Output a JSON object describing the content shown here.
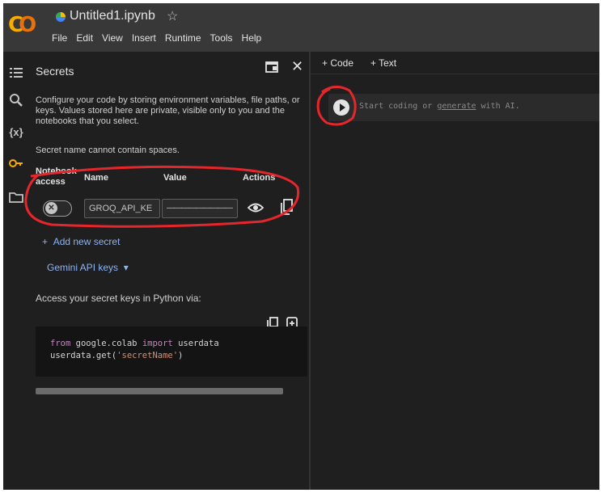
{
  "app": {
    "logo": "CO",
    "notebook_title": "Untitled1.ipynb"
  },
  "menu": [
    "File",
    "Edit",
    "View",
    "Insert",
    "Runtime",
    "Tools",
    "Help"
  ],
  "rail": [
    "toc-icon",
    "search-icon",
    "variables-icon",
    "key-icon",
    "folder-icon"
  ],
  "rail_variables_label": "{x}",
  "secrets": {
    "title": "Secrets",
    "description": "Configure your code by storing environment variables, file paths, or keys. Values stored here are private, visible only to you and the notebooks that you select.",
    "warning": "Secret name cannot contain spaces.",
    "columns": {
      "access": "Notebook access",
      "name": "Name",
      "value": "Value",
      "actions": "Actions"
    },
    "row": {
      "name": "GROQ_API_KE",
      "value": "—————————",
      "access_enabled": false
    },
    "add_secret": "Add new secret",
    "gemini_keys": "Gemini API keys",
    "access_text": "Access your secret keys in Python via:",
    "code_line1_kw1": "from",
    "code_line1_mod": " google.colab ",
    "code_line1_kw2": "import",
    "code_line1_name": " userdata",
    "code_line2_a": "userdata.get(",
    "code_line2_str": "'secretName'",
    "code_line2_b": ")"
  },
  "notebook": {
    "add_code": "Code",
    "add_text": "Text",
    "cell_placeholder_a": "Start coding or ",
    "cell_placeholder_link": "generate",
    "cell_placeholder_b": " with AI."
  },
  "colors": {
    "accent_link": "#8ab4f8",
    "annotation": "#e5262b",
    "logo_yellow": "#f9ab00",
    "logo_orange": "#e8710a"
  }
}
